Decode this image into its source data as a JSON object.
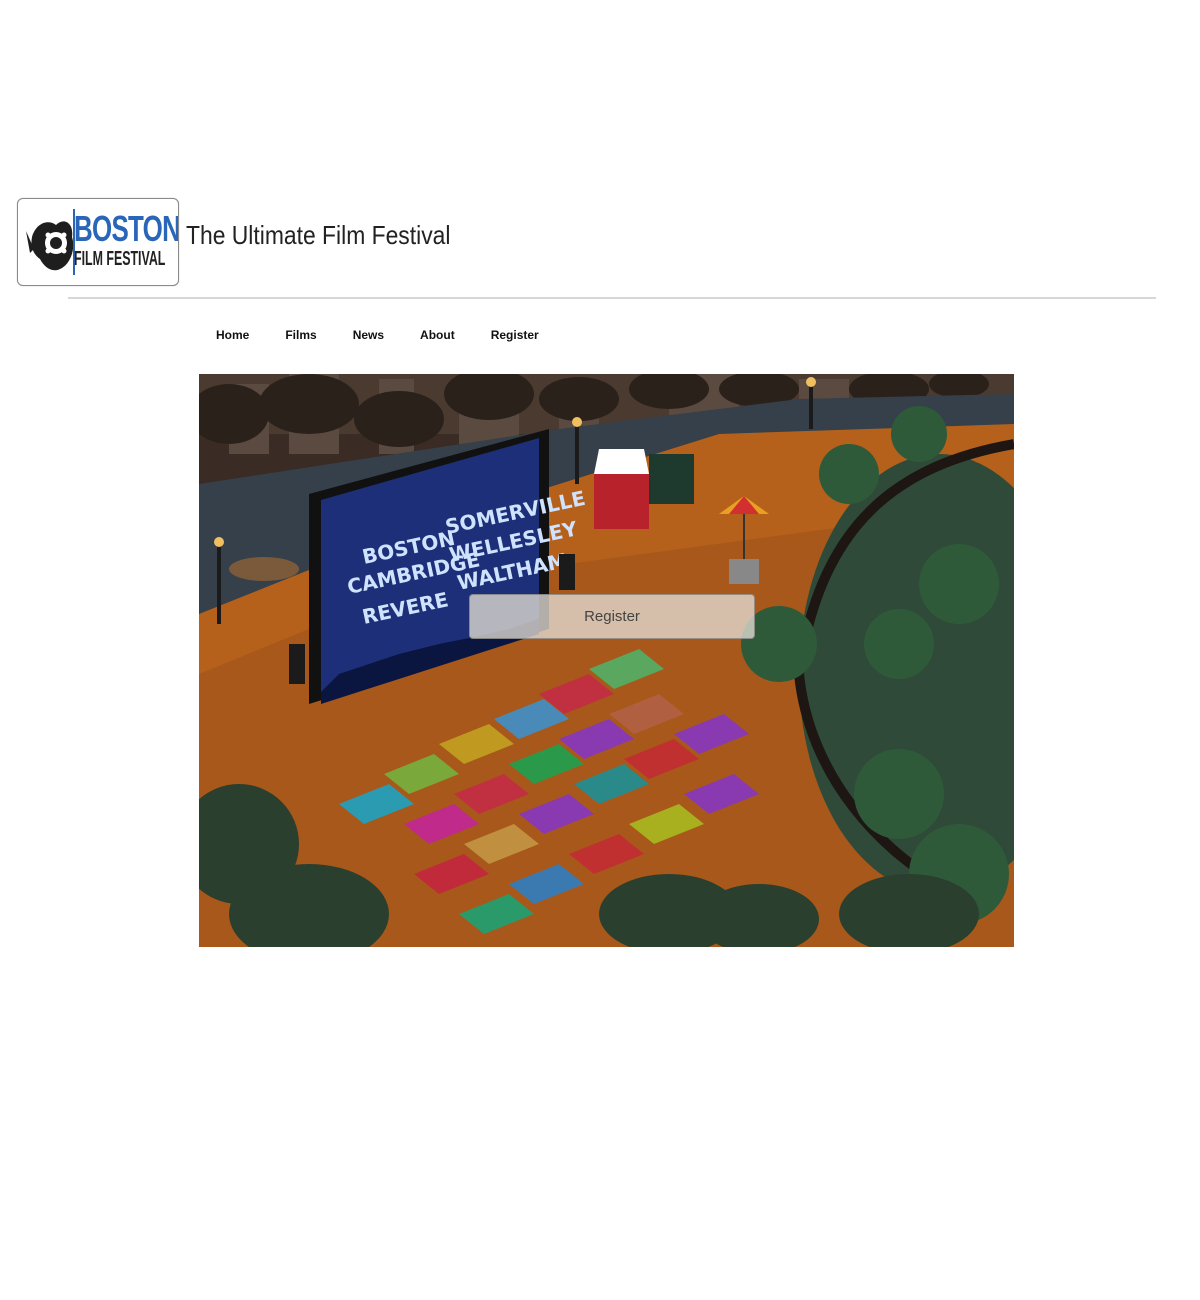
{
  "header": {
    "logo": {
      "line1": "BOSTON",
      "line2": "FILM FESTIVAL",
      "icon": "film-reel-logo-icon"
    },
    "tagline": "The Ultimate Film Festival"
  },
  "nav": {
    "items": [
      {
        "label": "Home"
      },
      {
        "label": "Films"
      },
      {
        "label": "News"
      },
      {
        "label": "About"
      },
      {
        "label": "Register"
      }
    ]
  },
  "hero": {
    "screen_text_left": [
      "BOSTON",
      "CAMBRIDGE",
      "REVERE"
    ],
    "screen_text_right": [
      "SOMERVILLE",
      "WELLESLEY",
      "WALTHAM"
    ],
    "button_label": "Register"
  },
  "colors": {
    "logo_blue": "#2a66b8",
    "ground": "#b5611c",
    "screen": "#1c2f78",
    "sky": "#3a2c24"
  }
}
